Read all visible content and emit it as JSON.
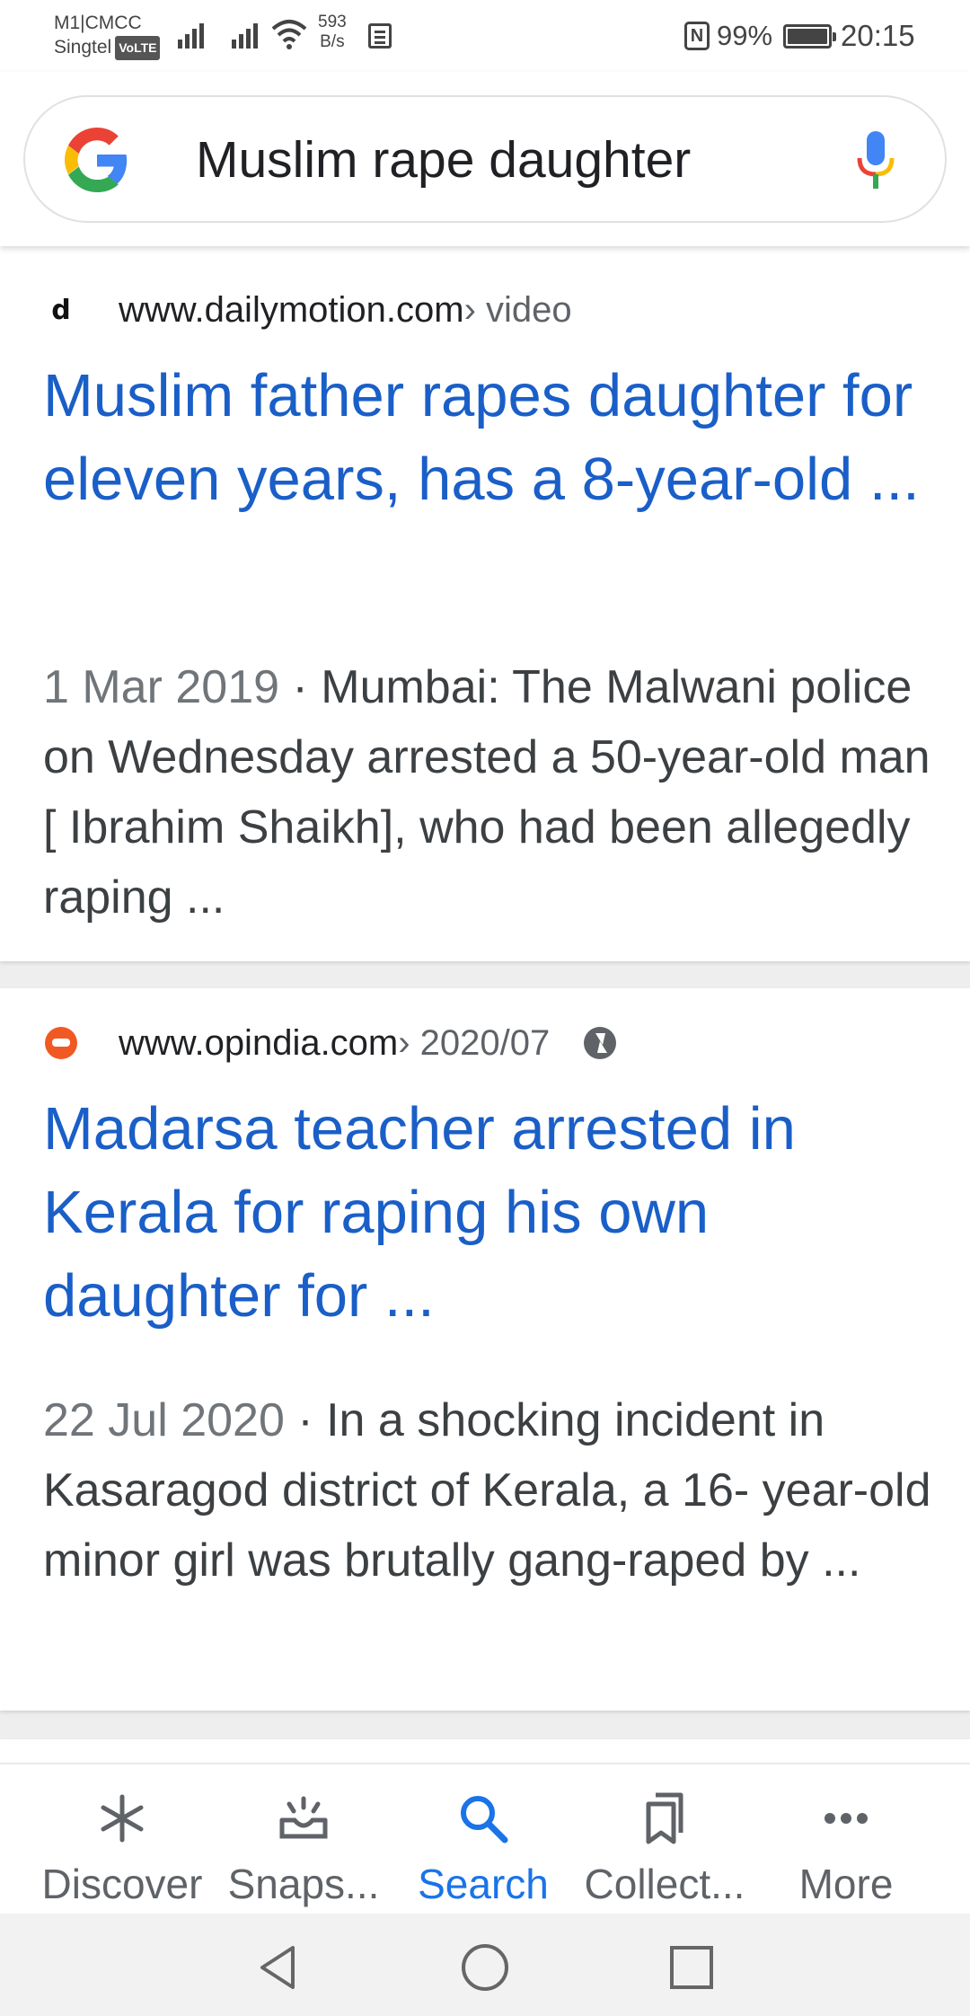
{
  "status_bar": {
    "carrier1": "M1|CMCC",
    "carrier2": "Singtel",
    "volte": "VoLTE",
    "netspeed_value": "593",
    "netspeed_unit": "B/s",
    "battery": "99%",
    "time": "20:15"
  },
  "search": {
    "query": "Muslim rape daughter"
  },
  "results": [
    {
      "site": "www.dailymotion.com",
      "path": " › video",
      "title": "Muslim father rapes daughter for eleven years, has a 8-year-old ...",
      "date": "1 Mar 2019",
      "snippet": " · Mumbai: The Malwani police on Wednesday arrested a 50-year-old man [ Ibrahim Shaikh], who had been allegedly raping ..."
    },
    {
      "site": "www.opindia.com",
      "path": " › 2020/07",
      "title": "Madarsa teacher arrested in Kerala for raping his own daughter for ...",
      "date": "22 Jul 2020",
      "snippet": " · In a shocking incident in Kasaragod district of Kerala, a 16- year-old minor girl was brutally gang-raped by ..."
    }
  ],
  "bottom_nav": {
    "discover": "Discover",
    "snapshot": "Snaps...",
    "search": "Search",
    "collections": "Collect...",
    "more": "More"
  },
  "colors": {
    "link": "#1a5fc8",
    "accent": "#1a73e8",
    "text": "#202124",
    "muted": "#70757a"
  }
}
